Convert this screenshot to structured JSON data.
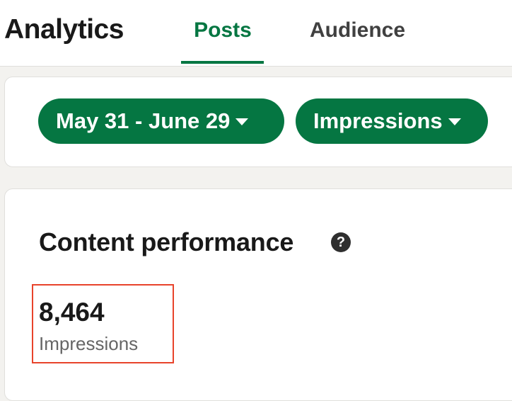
{
  "header": {
    "title": "Analytics",
    "tabs": [
      {
        "label": "Posts",
        "active": true
      },
      {
        "label": "Audience",
        "active": false
      }
    ]
  },
  "filters": {
    "date_range": "May 31 - June 29",
    "metric": "Impressions"
  },
  "content_performance": {
    "title": "Content performance",
    "help_glyph": "?",
    "metric_value": "8,464",
    "metric_label": "Impressions"
  },
  "colors": {
    "accent": "#057642",
    "highlight": "#e8432b",
    "background": "#f3f2ef"
  }
}
